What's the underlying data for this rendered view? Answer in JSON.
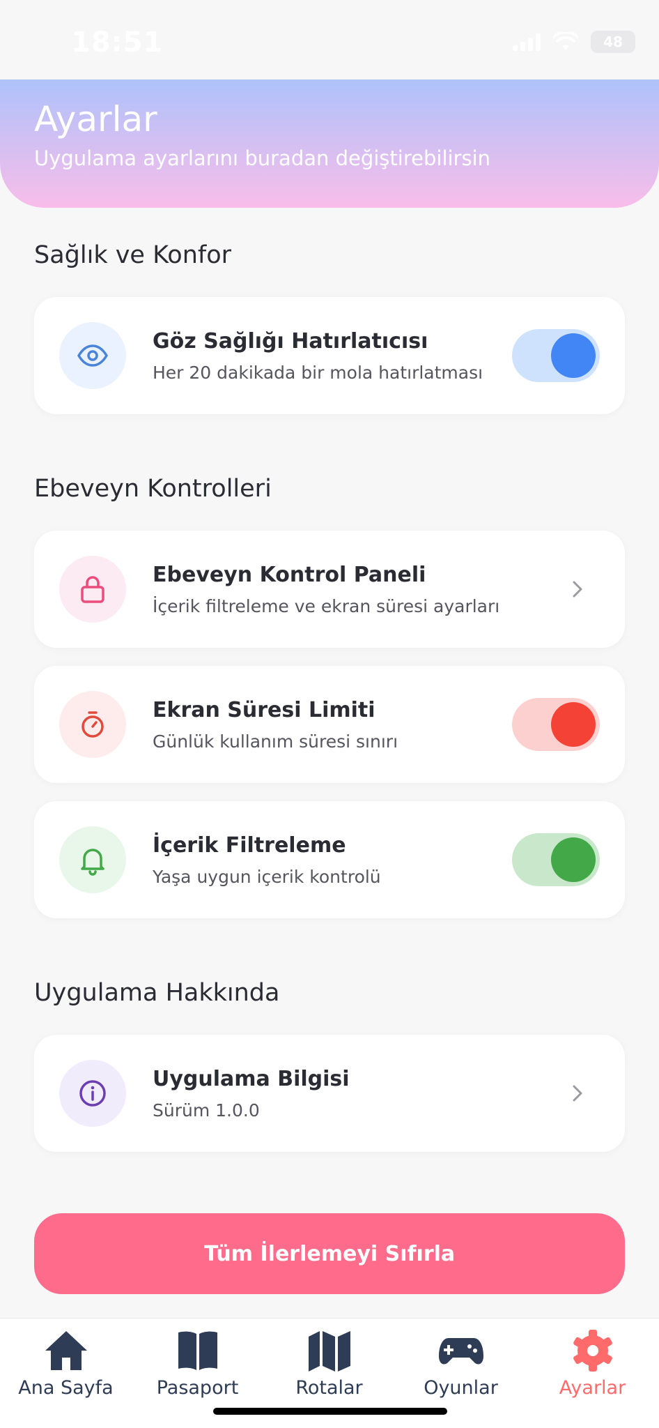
{
  "status_bar": {
    "time": "18:51",
    "battery": "48"
  },
  "header": {
    "title": "Ayarlar",
    "subtitle": "Uygulama ayarlarını buradan değiştirebilirsin"
  },
  "sections": {
    "health": {
      "title": "Sağlık ve Konfor",
      "eye_reminder": {
        "title": "Göz Sağlığı Hatırlatıcısı",
        "subtitle": "Her 20 dakikada bir mola hatırlatması",
        "enabled": true,
        "color": "#4285f4"
      }
    },
    "parental": {
      "title": "Ebeveyn Kontrolleri",
      "control_panel": {
        "title": "Ebeveyn Kontrol Paneli",
        "subtitle": "İçerik filtreleme ve ekran süresi ayarları",
        "color": "#ec4c7c"
      },
      "screen_time": {
        "title": "Ekran Süresi Limiti",
        "subtitle": "Günlük kullanım süresi sınırı",
        "enabled": true,
        "color": "#f44336"
      },
      "content_filter": {
        "title": "İçerik Filtreleme",
        "subtitle": "Yaşa uygun içerik kontrolü",
        "enabled": true,
        "color": "#43a847"
      }
    },
    "about": {
      "title": "Uygulama Hakkında",
      "app_info": {
        "title": "Uygulama Bilgisi",
        "subtitle": "Sürüm 1.0.0",
        "color": "#6b3fb3"
      }
    }
  },
  "reset_button": {
    "label": "Tüm İlerlemeyi Sıfırla",
    "color": "#ff6b8a"
  },
  "tab_bar": {
    "items": [
      {
        "label": "Ana Sayfa",
        "icon": "home-icon"
      },
      {
        "label": "Pasaport",
        "icon": "book-icon"
      },
      {
        "label": "Rotalar",
        "icon": "map-icon"
      },
      {
        "label": "Oyunlar",
        "icon": "gamepad-icon"
      },
      {
        "label": "Ayarlar",
        "icon": "gear-icon",
        "active": true
      }
    ],
    "active_color": "#ff6b6b",
    "inactive_color": "#2e3c55"
  }
}
